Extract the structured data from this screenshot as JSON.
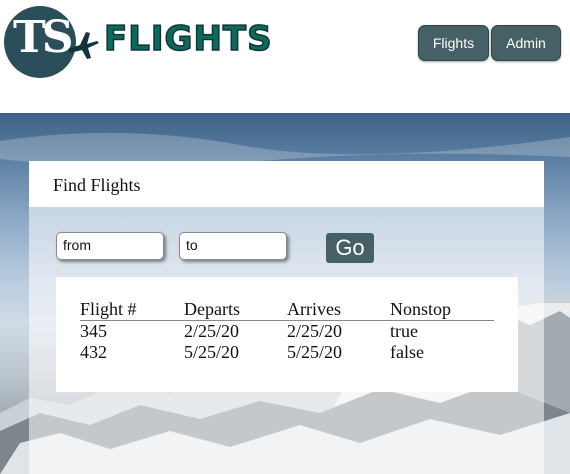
{
  "header": {
    "logo_mark": "TS",
    "logo_word": "FLIGHTS",
    "nav": [
      {
        "label": "Flights"
      },
      {
        "label": "Admin"
      }
    ]
  },
  "search": {
    "title": "Find Flights",
    "from_value": "from",
    "to_value": "to",
    "go_label": "Go"
  },
  "results": {
    "columns": [
      "Flight #",
      "Departs",
      "Arrives",
      "Nonstop"
    ],
    "rows": [
      [
        "345",
        "2/25/20",
        "2/25/20",
        "true"
      ],
      [
        "432",
        "5/25/20",
        "5/25/20",
        "false"
      ]
    ]
  },
  "colors": {
    "brand_dark": "#2a4f5a",
    "brand_green": "#0b6b5a",
    "button": "#466166"
  }
}
